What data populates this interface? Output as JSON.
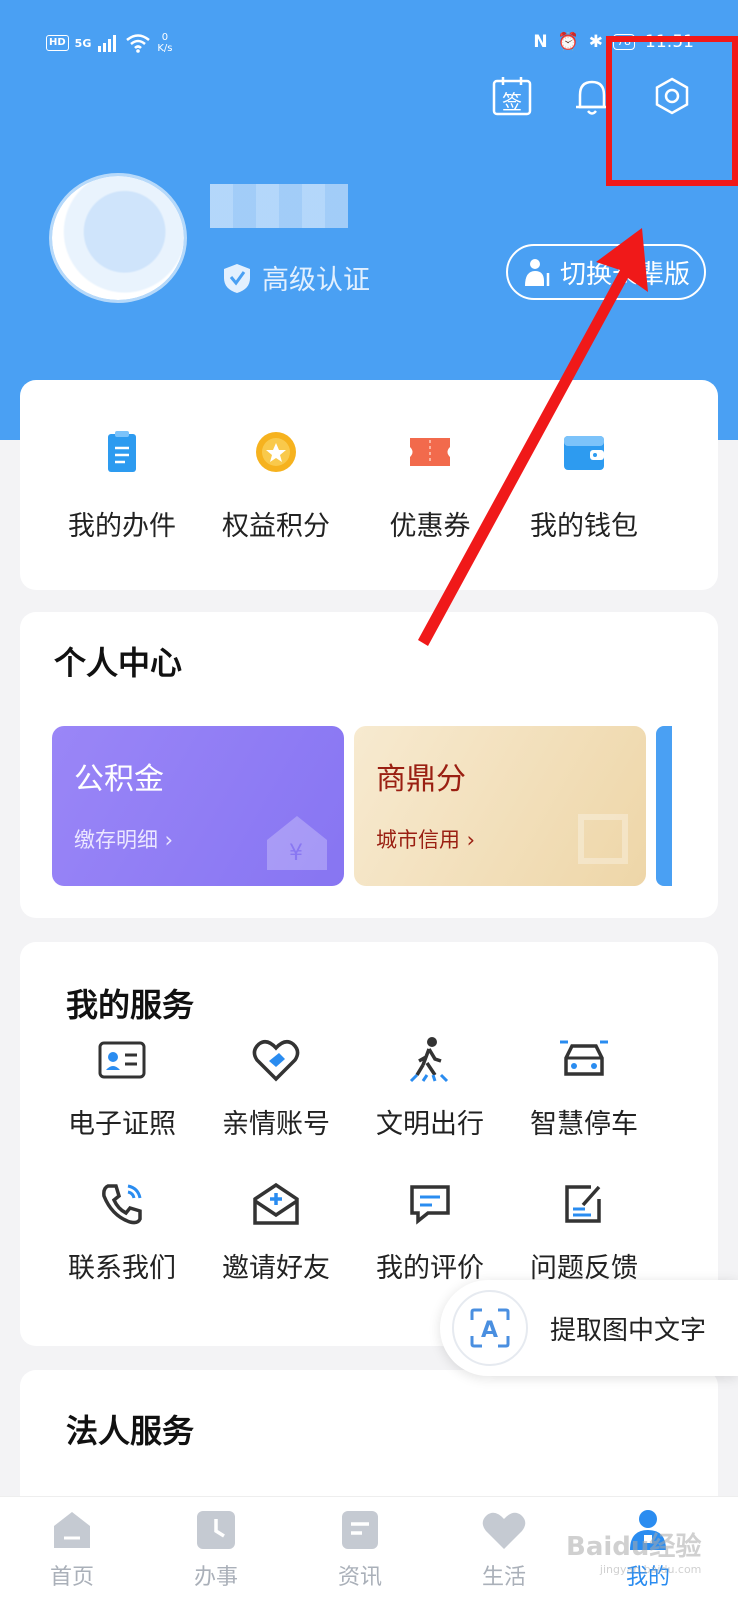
{
  "status_bar": {
    "hd": "HD",
    "signal": "5G",
    "net_speed_top": "0",
    "net_speed_unit": "K/s",
    "battery": "78",
    "time": "11:51"
  },
  "header": {
    "sign_label": "签",
    "user_badge": "高级认证",
    "switch_label": "切换长辈版"
  },
  "quick_actions": [
    {
      "label": "我的办件",
      "icon": "document-icon",
      "color": "#2d9bf0"
    },
    {
      "label": "权益积分",
      "icon": "star-coin-icon",
      "color": "#f6b21e"
    },
    {
      "label": "优惠券",
      "icon": "coupon-icon",
      "color": "#f26a4c"
    },
    {
      "label": "我的钱包",
      "icon": "wallet-icon",
      "color": "#2d9bf0"
    }
  ],
  "personal_center": {
    "title": "个人中心",
    "tiles": [
      {
        "title": "公积金",
        "subtitle": "缴存明细 ›"
      },
      {
        "title": "商鼎分",
        "subtitle": "城市信用 ›"
      }
    ]
  },
  "my_services": {
    "title": "我的服务",
    "items": [
      {
        "label": "电子证照",
        "icon": "id-card-icon"
      },
      {
        "label": "亲情账号",
        "icon": "heart-hands-icon"
      },
      {
        "label": "文明出行",
        "icon": "pedestrian-icon"
      },
      {
        "label": "智慧停车",
        "icon": "car-icon"
      },
      {
        "label": "联系我们",
        "icon": "phone-icon"
      },
      {
        "label": "邀请好友",
        "icon": "invite-mail-icon"
      },
      {
        "label": "我的评价",
        "icon": "comment-icon"
      },
      {
        "label": "问题反馈",
        "icon": "feedback-edit-icon"
      }
    ]
  },
  "legal_services": {
    "title": "法人服务"
  },
  "ocr_float": {
    "label": "提取图中文字",
    "icon_letter": "A"
  },
  "tabs": [
    {
      "label": "首页",
      "icon": "home-icon"
    },
    {
      "label": "办事",
      "icon": "clock-icon"
    },
    {
      "label": "资讯",
      "icon": "news-icon"
    },
    {
      "label": "生活",
      "icon": "heart-icon"
    },
    {
      "label": "我的",
      "icon": "profile-icon",
      "active": true
    }
  ],
  "watermark": {
    "text": "Baidu经验",
    "sub": "jingyan.baidu.com"
  },
  "colors": {
    "header_blue": "#4aa0f3",
    "accent_blue": "#2a8cf0",
    "highlight_red": "#f01919",
    "purple_tile": "#8f7ef5",
    "gold_tile": "#f2dfba"
  }
}
